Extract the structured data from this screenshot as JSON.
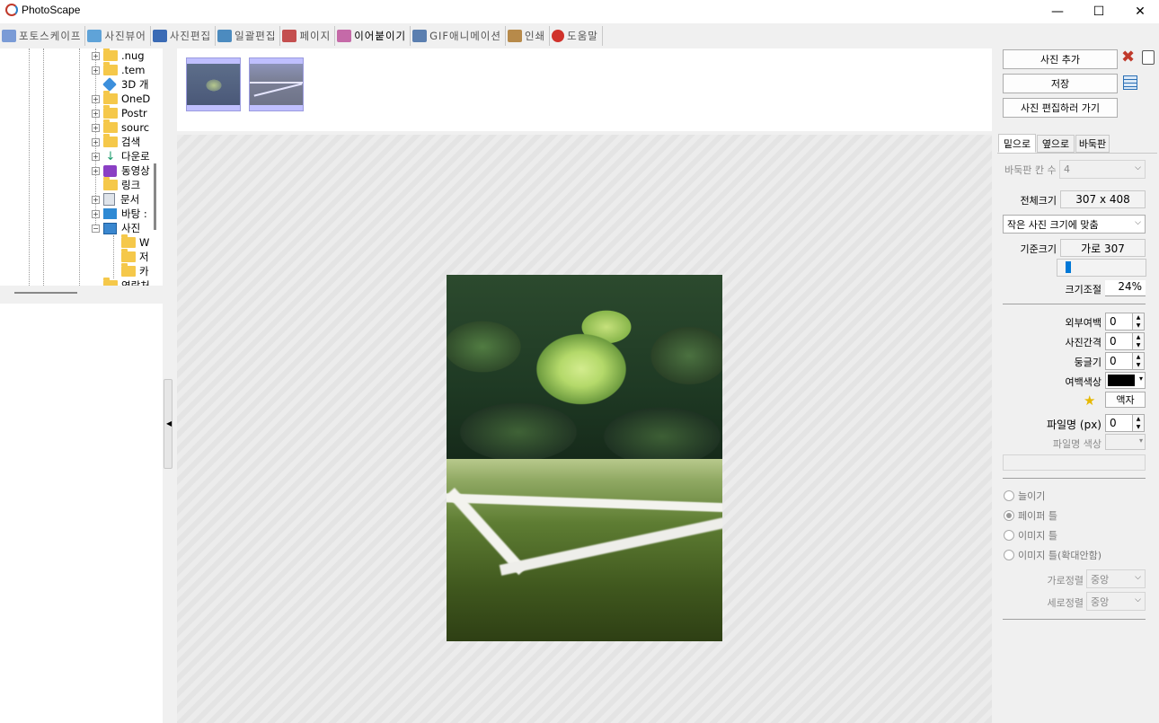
{
  "window": {
    "title": "PhotoScape",
    "minimize": "—",
    "maximize": "☐",
    "close": "✕"
  },
  "tabs": [
    {
      "label": "포토스케이프",
      "color": "#7a9bd6"
    },
    {
      "label": "사진뷰어",
      "color": "#5fa3d8"
    },
    {
      "label": "사진편집",
      "color": "#3b6bb5"
    },
    {
      "label": "일괄편집",
      "color": "#4c8bbf"
    },
    {
      "label": "페이지",
      "color": "#c44f4f"
    },
    {
      "label": "이어붙이기",
      "color": "#c56aa8"
    },
    {
      "label": "GIF애니메이션",
      "color": "#5b7fb0"
    },
    {
      "label": "인쇄",
      "color": "#b78a4a"
    },
    {
      "label": "도움말",
      "color": "#d0322b"
    }
  ],
  "tree": {
    "items": [
      {
        "label": ".nug",
        "type": "folder",
        "expander": "+"
      },
      {
        "label": ".tem",
        "type": "folder",
        "expander": "+"
      },
      {
        "label": "3D 개",
        "type": "3d",
        "expander": ""
      },
      {
        "label": "OneD",
        "type": "folder",
        "expander": "+"
      },
      {
        "label": "Postr",
        "type": "folder",
        "expander": "+"
      },
      {
        "label": "sourc",
        "type": "folder",
        "expander": "+"
      },
      {
        "label": "검색",
        "type": "folder",
        "expander": "+"
      },
      {
        "label": "다운로",
        "type": "download",
        "expander": "+"
      },
      {
        "label": "동영상",
        "type": "video",
        "expander": "+"
      },
      {
        "label": "링크",
        "type": "folder",
        "expander": ""
      },
      {
        "label": "문서",
        "type": "doc",
        "expander": "+"
      },
      {
        "label": "바탕 :",
        "type": "desktop",
        "expander": "+"
      },
      {
        "label": "사진",
        "type": "pictures",
        "expander": "−"
      },
      {
        "label": "W",
        "type": "folder",
        "expander": ""
      },
      {
        "label": "저",
        "type": "folder",
        "expander": ""
      },
      {
        "label": "카",
        "type": "folder",
        "expander": ""
      },
      {
        "label": "연락처",
        "type": "folder",
        "expander": ""
      }
    ]
  },
  "right": {
    "add_photo": "사진 추가",
    "save": "저장",
    "go_edit": "사진 편집하러 가기",
    "tabs": [
      "밑으로",
      "옆으로",
      "바둑판"
    ],
    "grid_cols_label": "바둑판 칸 수",
    "grid_cols_value": "4",
    "total_size_label": "전체크기",
    "total_size_value": "307 x 408",
    "fit_option": "작은 사진 크기에 맞춤",
    "base_size_label": "기준크기",
    "base_size_value": "가로 307",
    "scale_label": "크기조절",
    "scale_value": "24%",
    "outer_margin_label": "외부여백",
    "outer_margin_value": "0",
    "photo_gap_label": "사진간격",
    "photo_gap_value": "0",
    "round_label": "둥글기",
    "round_value": "0",
    "margin_color_label": "여백색상",
    "margin_color": "#000000",
    "frame_button": "액자",
    "filename_label": "파일명 (px)",
    "filename_value": "0",
    "filename_color_label": "파일명 색상",
    "radios": [
      {
        "label": "늘이기",
        "checked": false
      },
      {
        "label": "페이퍼 틀",
        "checked": true
      },
      {
        "label": "이미지 틀",
        "checked": false
      },
      {
        "label": "이미지 틀(확대안함)",
        "checked": false
      }
    ],
    "h_align_label": "가로정렬",
    "h_align_value": "중앙",
    "v_align_label": "세로정렬",
    "v_align_value": "중앙"
  }
}
